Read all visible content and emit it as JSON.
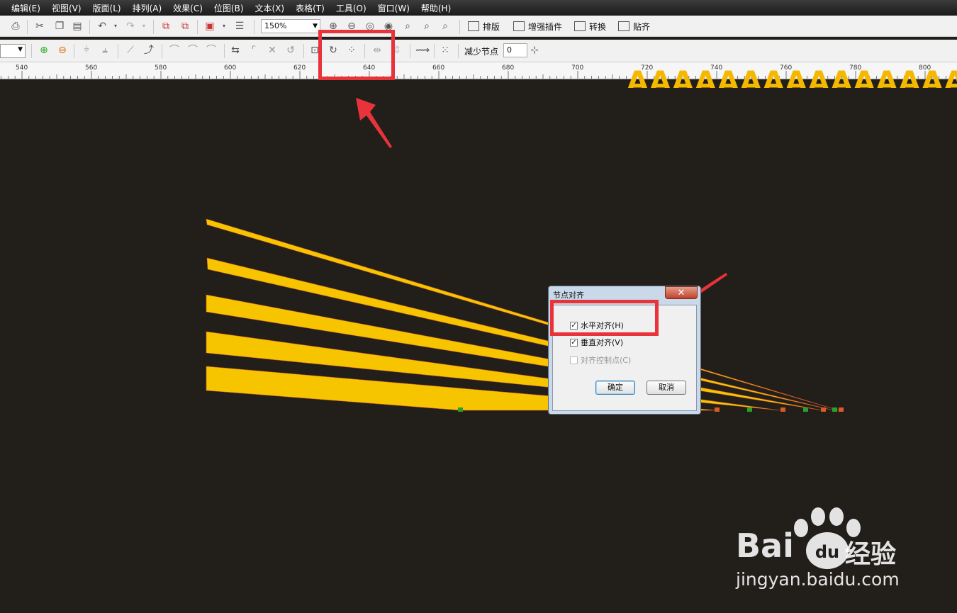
{
  "menu": [
    "编辑(E)",
    "视图(V)",
    "版面(L)",
    "排列(A)",
    "效果(C)",
    "位图(B)",
    "文本(X)",
    "表格(T)",
    "工具(O)",
    "窗口(W)",
    "帮助(H)"
  ],
  "toolbar1": {
    "zoom": "150%",
    "buttons": [
      "排版",
      "增强插件",
      "转换",
      "贴齐"
    ]
  },
  "toolbar2": {
    "reduce_nodes_label": "减少节点",
    "reduce_nodes_value": "0"
  },
  "ruler": {
    "labels": [
      "540",
      "560",
      "580",
      "600",
      "620",
      "640",
      "660",
      "680",
      "700",
      "720",
      "740",
      "760",
      "780",
      "800"
    ]
  },
  "canvas": {
    "big_text": "AAAAAAAAAAAAAAAAAA",
    "shape_color": "#f7c400"
  },
  "dialog": {
    "title": "节点对齐",
    "close": "✕",
    "options": [
      {
        "label": "水平对齐(H)",
        "checked": true,
        "enabled": true
      },
      {
        "label": "垂直对齐(V)",
        "checked": true,
        "enabled": true
      },
      {
        "label": "对齐控制点(C)",
        "checked": false,
        "enabled": false
      }
    ],
    "ok_label": "确定",
    "cancel_label": "取消"
  },
  "watermark": {
    "brand": "Bai",
    "brand_tail": "经验",
    "paw_text": "du",
    "url": "jingyan.baidu.com"
  },
  "colors": {
    "highlight": "#e8333a",
    "canvas_bg": "#221f1b"
  }
}
